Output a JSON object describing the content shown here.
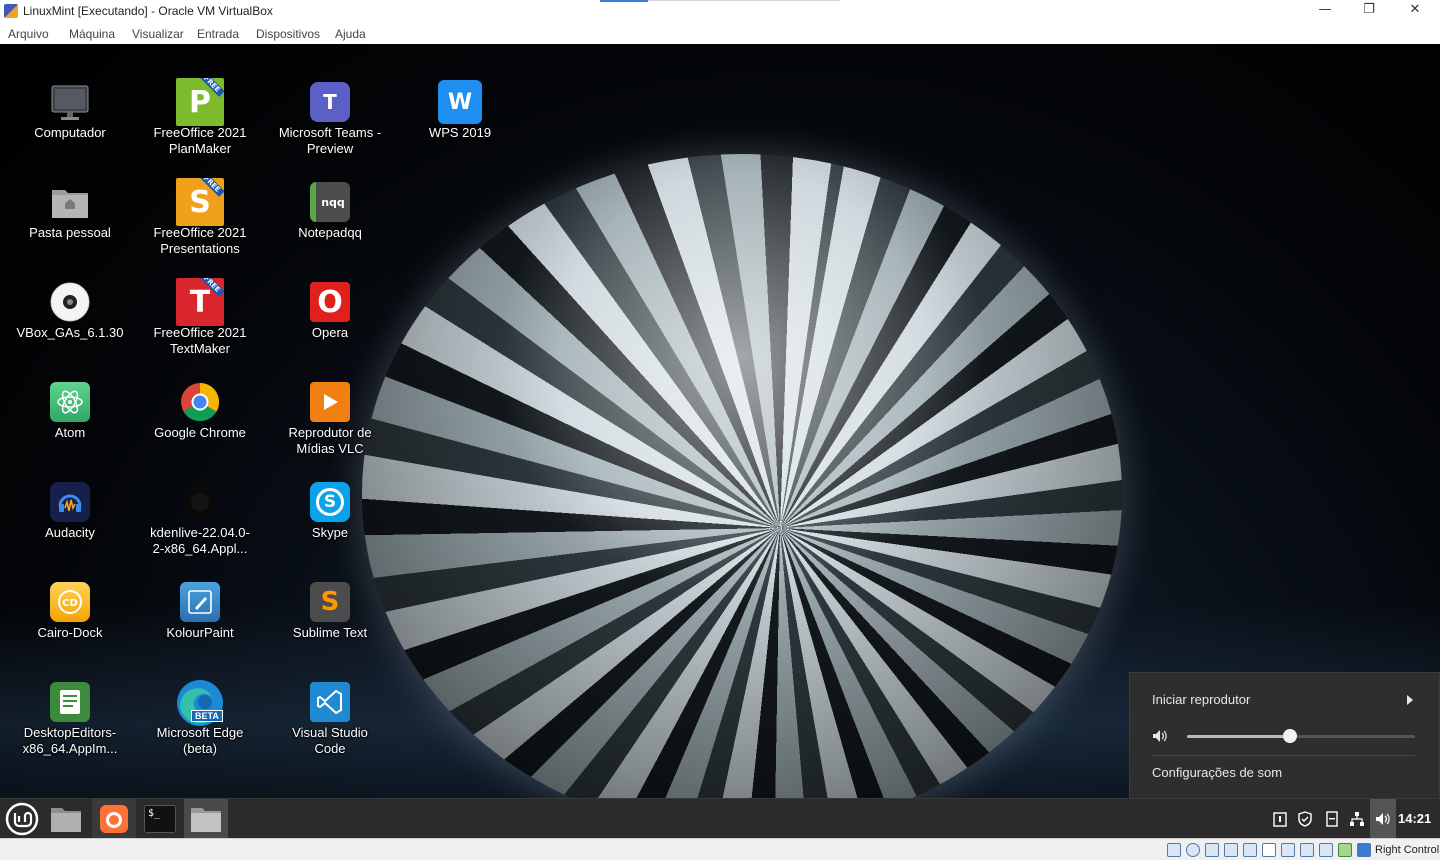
{
  "window": {
    "title": "LinuxMint [Executando] - Oracle VM VirtualBox",
    "controls": {
      "minimize": "—",
      "restore": "❐",
      "close": "✕"
    }
  },
  "menu": [
    "Arquivo",
    "Máquina",
    "Visualizar",
    "Entrada",
    "Dispositivos",
    "Ajuda"
  ],
  "desktop_icons": [
    {
      "label": "Computador",
      "icon": "monitor-icon"
    },
    {
      "label": "Pasta pessoal",
      "icon": "home-folder-icon"
    },
    {
      "label": "VBox_GAs_6.1.30",
      "icon": "disc-icon"
    },
    {
      "label": "Atom",
      "icon": "atom-icon"
    },
    {
      "label": "Audacity",
      "icon": "audacity-icon"
    },
    {
      "label": "Cairo-Dock",
      "icon": "cairo-dock-icon"
    },
    {
      "label": "DesktopEditors-\nx86_64.AppIm...",
      "icon": "desktop-editors-icon"
    },
    {
      "label": "FreeOffice 2021\nPlanMaker",
      "icon": "planmaker-icon",
      "letter": "P"
    },
    {
      "label": "FreeOffice 2021\nPresentations",
      "icon": "presentations-icon",
      "letter": "S"
    },
    {
      "label": "FreeOffice 2021\nTextMaker",
      "icon": "textmaker-icon",
      "letter": "T"
    },
    {
      "label": "Google Chrome",
      "icon": "chrome-icon"
    },
    {
      "label": "kdenlive-22.04.0-\n2-x86_64.Appl...",
      "icon": "kdenlive-icon"
    },
    {
      "label": "KolourPaint",
      "icon": "kolourpaint-icon"
    },
    {
      "label": "Microsoft Edge\n(beta)",
      "icon": "edge-beta-icon",
      "badge": "BETA"
    },
    {
      "label": "Microsoft Teams -\nPreview",
      "icon": "teams-icon",
      "letter": "T"
    },
    {
      "label": "Notepadqq",
      "icon": "notepadqq-icon",
      "text": "nqq"
    },
    {
      "label": "Opera",
      "icon": "opera-icon",
      "letter": "O"
    },
    {
      "label": "Reprodutor de\nMídias VLC",
      "icon": "vlc-icon"
    },
    {
      "label": "Skype",
      "icon": "skype-icon",
      "letter": "S"
    },
    {
      "label": "Sublime Text",
      "icon": "sublime-icon",
      "letter": "S"
    },
    {
      "label": "Visual Studio\nCode",
      "icon": "vscode-icon"
    },
    {
      "label": "WPS 2019",
      "icon": "wps-icon",
      "letter": "W"
    }
  ],
  "free_tag": "FREE",
  "sound_popup": {
    "start_player": "Iniciar reprodutor",
    "volume_percent": 45,
    "settings": "Configurações de som"
  },
  "taskbar": {
    "items": [
      "mint-menu-icon",
      "file-manager-icon",
      "firefox-icon",
      "terminal-icon",
      "folder-icon"
    ],
    "terminal_glyph": "$_",
    "clock": "14:21"
  },
  "statusbar": {
    "host_key": "Right Control"
  },
  "colors": {
    "taskbar": "#2b2b2b",
    "popup": "#2e2e2e",
    "mint_green": "#86be43"
  }
}
